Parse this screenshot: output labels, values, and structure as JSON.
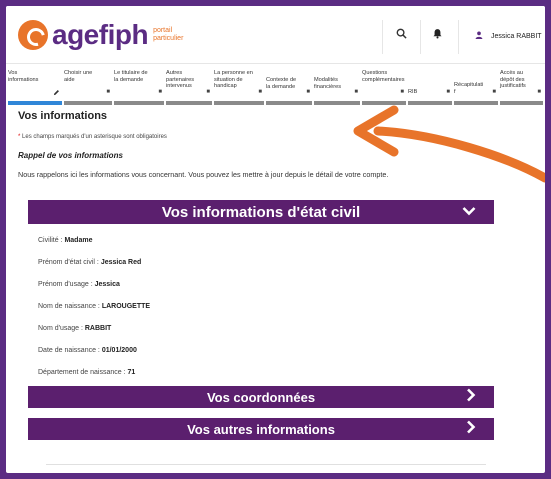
{
  "header": {
    "logo_text": "agefiph",
    "logo_sub": "portail particulier",
    "user_name": "Jessica RABBIT"
  },
  "steps": [
    {
      "label": "Vos informations",
      "icon": "pencil-icon"
    },
    {
      "label": "Choisir une aide",
      "icon": "lock-icon"
    },
    {
      "label": "Le titulaire de la demande",
      "icon": "lock-icon"
    },
    {
      "label": "Autres partenaires intervenus",
      "icon": "lock-icon"
    },
    {
      "label": "La personne en situation de handicap",
      "icon": "lock-icon"
    },
    {
      "label": "Contexte de la demande",
      "icon": "lock-icon"
    },
    {
      "label": "Modalités financières",
      "icon": "lock-icon"
    },
    {
      "label": "Questions complémentaires",
      "icon": "lock-icon"
    },
    {
      "label": "RIB",
      "icon": "lock-icon"
    },
    {
      "label": "Récapitulatif",
      "icon": "lock-icon"
    },
    {
      "label": "Accès au dépôt des justificatifs",
      "icon": "lock-icon"
    }
  ],
  "page": {
    "title": "Vos informations",
    "required_note": "Les champs marqués d'un asterisque sont obligatoires",
    "recall_title": "Rappel de vos informations",
    "intro": "Nous rappelons ici les informations vous concernant. Vous pouvez les mettre à jour depuis le détail de votre compte."
  },
  "sections": {
    "civil_title": "Vos informations d'état civil",
    "contact_title": "Vos coordonnées",
    "other_title": "Vos autres informations"
  },
  "civil": [
    {
      "label": "Civilité : ",
      "value": "Madame"
    },
    {
      "label": "Prénom d'état civil : ",
      "value": "Jessica Red"
    },
    {
      "label": "Prénom d'usage : ",
      "value": "Jessica"
    },
    {
      "label": "Nom de naissance : ",
      "value": "LAROUGETTE"
    },
    {
      "label": "Nom d'usage : ",
      "value": "RABBIT"
    },
    {
      "label": "Date de naissance : ",
      "value": "01/01/2000"
    },
    {
      "label": "Département de naissance : ",
      "value": "71"
    }
  ],
  "colors": {
    "brand_purple": "#5b2c83",
    "accordion": "#5b1f6e",
    "brand_orange": "#e8742a",
    "active_step": "#2f86d8"
  }
}
